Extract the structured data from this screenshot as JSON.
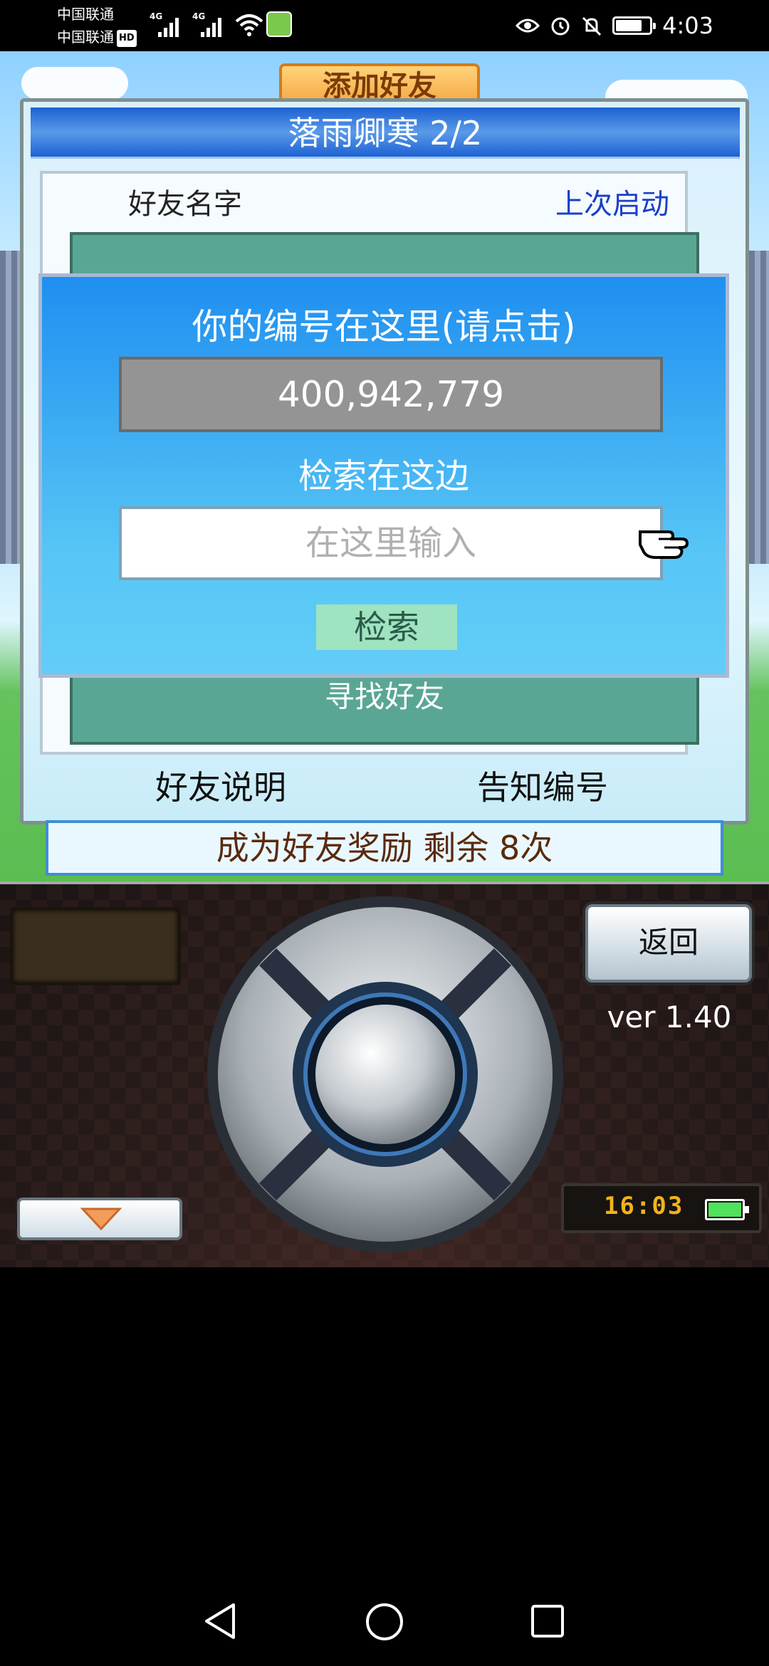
{
  "status_bar": {
    "carrier1": "中国联通",
    "carrier2": "中国联通",
    "hd_badge": "HD",
    "network1": "4G",
    "network2": "4G",
    "time": "4:03",
    "icons": [
      "signal-icon",
      "signal-icon",
      "wifi-icon",
      "app-notification-icon",
      "eye-icon",
      "alarm-icon",
      "mute-icon",
      "battery-icon"
    ]
  },
  "game": {
    "title_tab": "添加好友",
    "panel": {
      "title": "落雨卿寒 2/2",
      "list_header_name": "好友名字",
      "list_header_last": "上次启动",
      "find_friend": "寻找好友",
      "footer_explain": "好友说明",
      "footer_tell_id": "告知编号"
    },
    "reward_bar": "成为好友奖励 剩余 8次",
    "search_dialog": {
      "your_id_label": "你的编号在这里(请点击)",
      "your_id": "400,942,779",
      "search_label": "检索在这边",
      "search_placeholder": "在这里输入",
      "search_button": "检索"
    },
    "controller": {
      "back_button": "返回",
      "version": "ver 1.40",
      "clock": "16:03",
      "colors": {
        "clock_digits": "#f3b21b",
        "battery_fill": "#4fe25a"
      }
    }
  },
  "nav_bar": {
    "icons": [
      "back-icon",
      "home-icon",
      "recents-icon"
    ]
  },
  "colors": {
    "panel_header": "#1d61d3",
    "dialog_blue": "#1f8ff0",
    "list_green": "#5aa695",
    "search_button": "#9fe3c0",
    "link_blue": "#1a3fc8",
    "reward_text": "#5a2a0c"
  }
}
